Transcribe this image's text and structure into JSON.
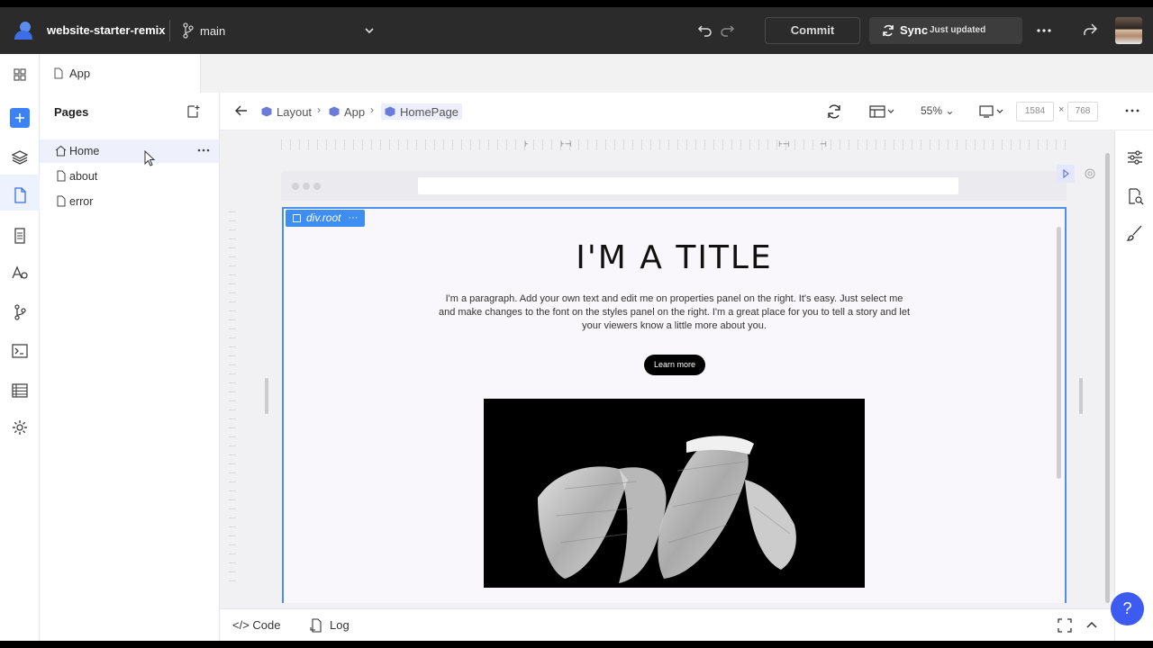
{
  "topbar": {
    "project_name": "website-starter-remix",
    "branch": "main",
    "commit_label": "Commit",
    "sync_label": "Sync",
    "sync_status": "Just updated"
  },
  "tabs": [
    {
      "label": "App"
    }
  ],
  "pages_panel": {
    "title": "Pages",
    "items": [
      {
        "label": "Home",
        "icon": "home-icon",
        "selected": true
      },
      {
        "label": "about",
        "icon": "file-icon",
        "selected": false
      },
      {
        "label": "error",
        "icon": "file-icon",
        "selected": false
      }
    ]
  },
  "breadcrumb": [
    {
      "label": "Layout"
    },
    {
      "label": "App"
    },
    {
      "label": "HomePage"
    }
  ],
  "toolbar": {
    "zoom": "55%",
    "width": "1584",
    "height": "768",
    "times": "×"
  },
  "canvas": {
    "selection_tag": "div.root",
    "selection_more": "···",
    "hero_title": "I'M A TITLE",
    "hero_paragraph": "I'm a paragraph. Add your own text and edit me on properties panel on the right. It's easy. Just select me and make changes to the font on the styles panel on the right. I'm a great place for you to tell a story and let your viewers know a little more about you.",
    "hero_button": "Learn more"
  },
  "bottombar": {
    "code_label": "Code",
    "code_prefix": "</>",
    "log_label": "Log"
  },
  "help_label": "?",
  "colors": {
    "topbar_bg": "#2b2b2b",
    "accent": "#3b82f6",
    "selection": "#3d8ef0",
    "help": "#3d5af1"
  }
}
